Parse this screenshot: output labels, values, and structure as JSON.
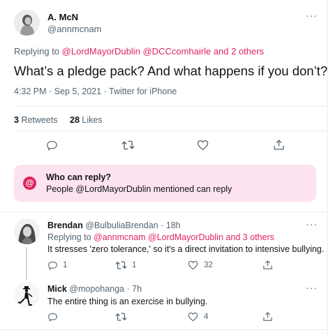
{
  "main_tweet": {
    "author_name": "A. McN",
    "author_handle": "@annmcnam",
    "replying_prefix": "Replying to",
    "replying_mentions": "@LordMayorDublin @DCCcomhairle and 2 others",
    "text": "What’s a pledge pack? And what happens if you don’t?",
    "timestamp": "4:32 PM · Sep 5, 2021 · Twitter for iPhone",
    "retweets_count": "3",
    "retweets_label": "Retweets",
    "likes_count": "28",
    "likes_label": "Likes"
  },
  "reply_restriction": {
    "icon": "at-sign-icon",
    "title": "Who can reply?",
    "text": "People @LordMayorDublin mentioned can reply",
    "background": "#fde2ef",
    "accent": "#e0245e"
  },
  "replies": [
    {
      "author_name": "Brendan",
      "author_handle": "@BulbuliaBrendan",
      "time": "· 18h",
      "replying_prefix": "Replying to",
      "replying_mentions": "@annmcnam @LordMayorDublin and 3 others",
      "text": "It stresses 'zero tolerance,' so it's a direct invitation to intensive bullying.",
      "reply_count": "1",
      "retweet_count": "1",
      "like_count": "32"
    },
    {
      "author_name": "Mick",
      "author_handle": "@mopohanga",
      "time": "· 7h",
      "text": "The entire thing is an exercise in bullying.",
      "like_count": "4"
    }
  ],
  "more_label": "···",
  "colors": {
    "link": "#e0245e",
    "muted": "#536471",
    "divider": "#e6ecf0"
  }
}
